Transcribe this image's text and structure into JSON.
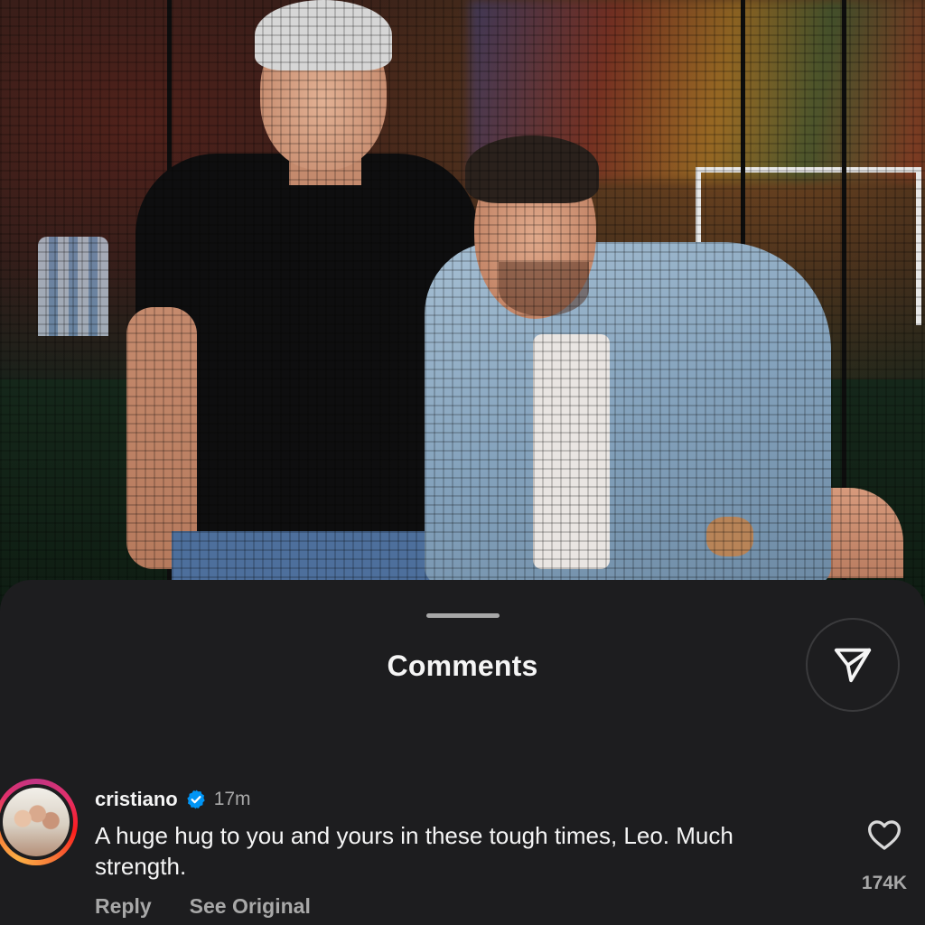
{
  "sheet": {
    "title": "Comments"
  },
  "comment": {
    "username": "cristiano",
    "time": "17m",
    "text": "A huge hug to you and yours in these tough times, Leo. Much strength.",
    "like_count": "174K",
    "reply_label": "Reply",
    "see_original_label": "See Original",
    "verified": true
  },
  "icons": {
    "share": "paper-plane-icon",
    "like": "heart-icon",
    "verified": "verified-badge-icon"
  },
  "colors": {
    "sheet_background": "#1d1d1f",
    "text_primary": "#f5f5f5",
    "text_secondary": "#a8a8a8",
    "verified_blue": "#0095f6"
  }
}
